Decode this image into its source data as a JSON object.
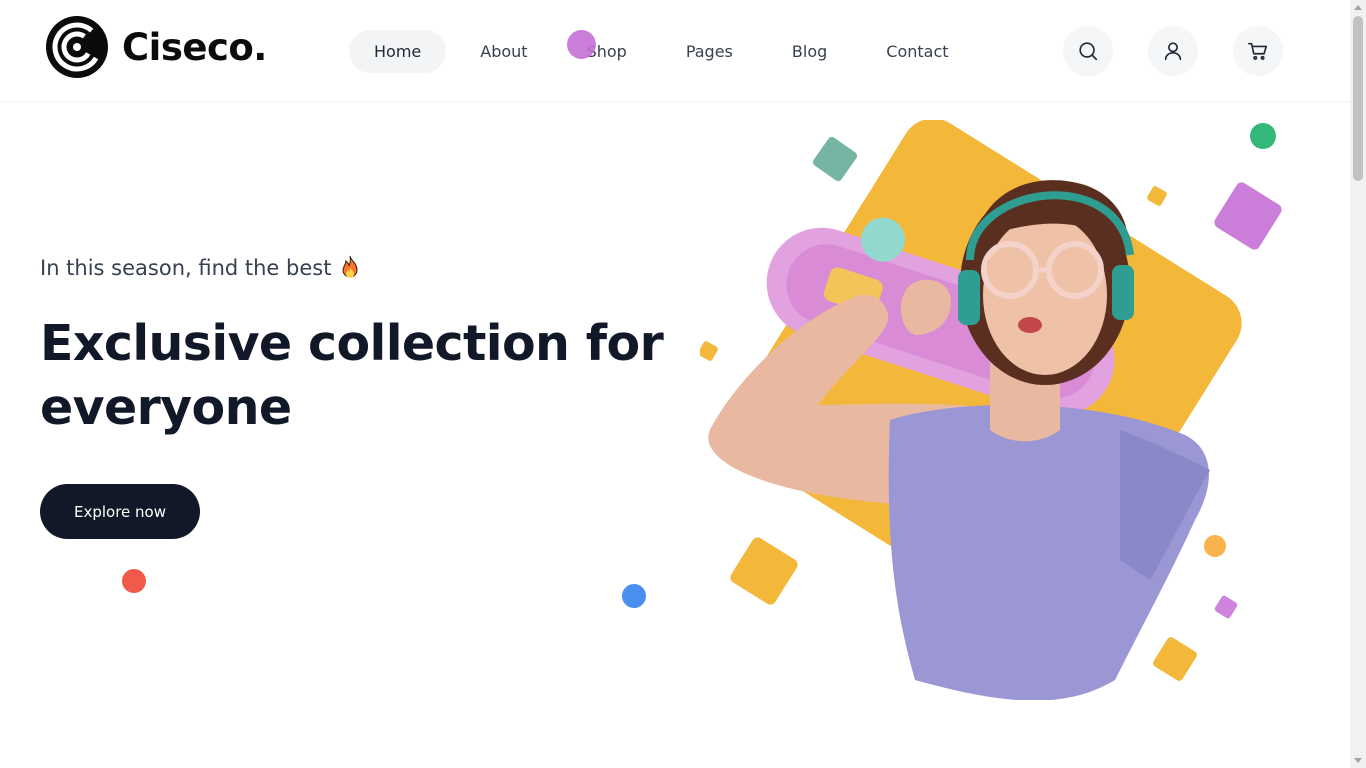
{
  "brand": {
    "name": "Ciseco.",
    "logo_icon": "ciseco-logo-icon"
  },
  "nav": {
    "items": [
      {
        "label": "Home",
        "active": true
      },
      {
        "label": "About",
        "active": false
      },
      {
        "label": "Shop",
        "active": false
      },
      {
        "label": "Pages",
        "active": false
      },
      {
        "label": "Blog",
        "active": false
      },
      {
        "label": "Contact",
        "active": false
      }
    ]
  },
  "header_actions": {
    "search_icon": "search-icon",
    "user_icon": "user-icon",
    "cart_icon": "cart-icon"
  },
  "hero": {
    "subtitle": "In this season, find the best",
    "subtitle_icon": "fire-emoji-icon",
    "headline": "Exclusive collection for everyone",
    "cta_label": "Explore now"
  },
  "colors": {
    "primary_dark": "#111827",
    "accent_yellow": "#f3b73a",
    "accent_purple": "#c56fd6",
    "accent_green": "#34b87a",
    "accent_blue": "#4a8ef0",
    "accent_red": "#f05a4a",
    "accent_teal": "#76b5a4"
  }
}
